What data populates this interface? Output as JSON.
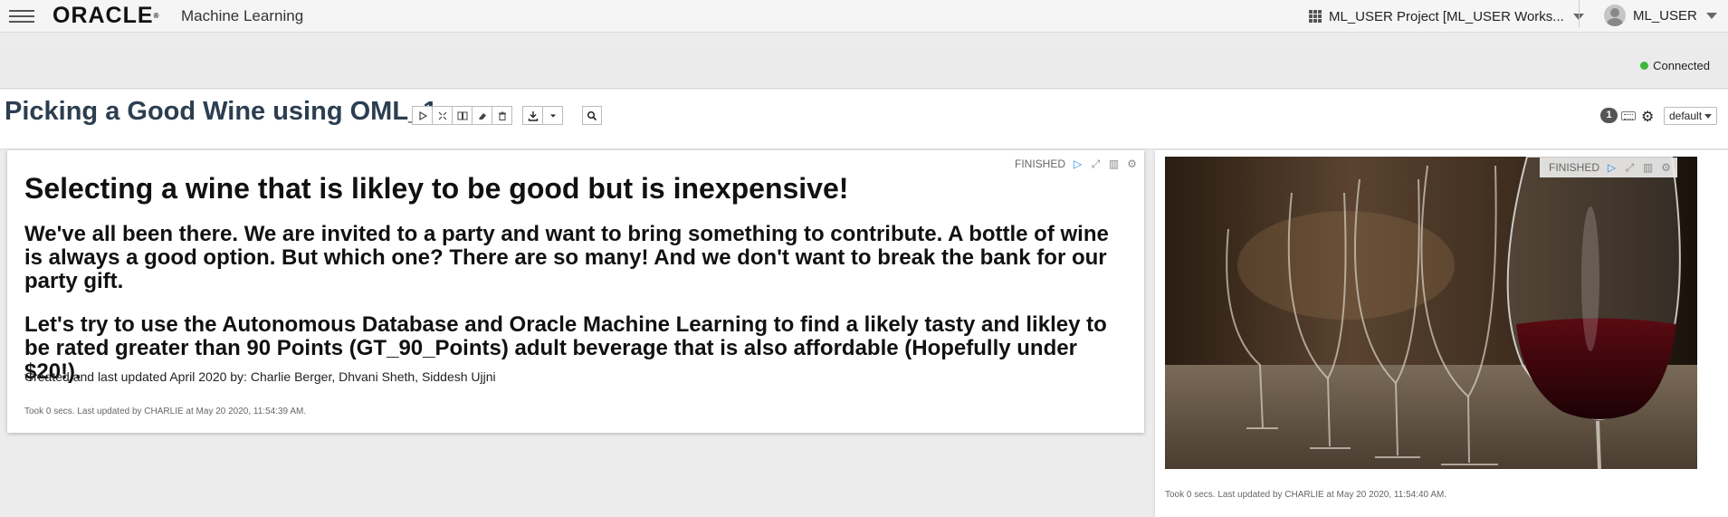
{
  "header": {
    "logo_text": "ORACLE",
    "product_name": "Machine Learning",
    "project_label": "ML_USER Project [ML_USER Works...",
    "user_name": "ML_USER"
  },
  "status": {
    "connection": "Connected",
    "connection_color": "#3cb93c"
  },
  "notebook": {
    "title": "Picking a Good Wine using OML_1",
    "badge_count": "1",
    "interpreter_default": "default"
  },
  "paragraph1": {
    "status": "FINISHED",
    "heading": "Selecting a wine that is likley to be good but is inexpensive!",
    "body1": "We've all been there. We are invited to a party and want to bring something to contribute. A bottle of wine is always a good option. But which one? There are so many! And we don't want to break the bank for our party gift.",
    "body2": "Let's try to use the Autonomous Database and Oracle Machine Learning to find a likely tasty and likley to be rated greater than 90 Points (GT_90_Points) adult beverage that is also affordable (Hopefully under $20!).",
    "credit": "Created and last updated April 2020 by: Charlie Berger, Dhvani Sheth, Siddesh Ujjni",
    "took": "Took 0 secs. Last updated by CHARLIE at May 20 2020, 11:54:39 AM."
  },
  "paragraph2": {
    "status": "FINISHED",
    "took": "Took 0 secs. Last updated by CHARLIE at May 20 2020, 11:54:40 AM."
  },
  "icons": [
    "menu-icon",
    "grid-icon",
    "chevron-down-icon",
    "avatar",
    "play-icon",
    "expand-icon",
    "book-icon",
    "eraser-icon",
    "trash-icon",
    "download-icon",
    "search-icon",
    "keyboard-icon",
    "gear-icon"
  ]
}
